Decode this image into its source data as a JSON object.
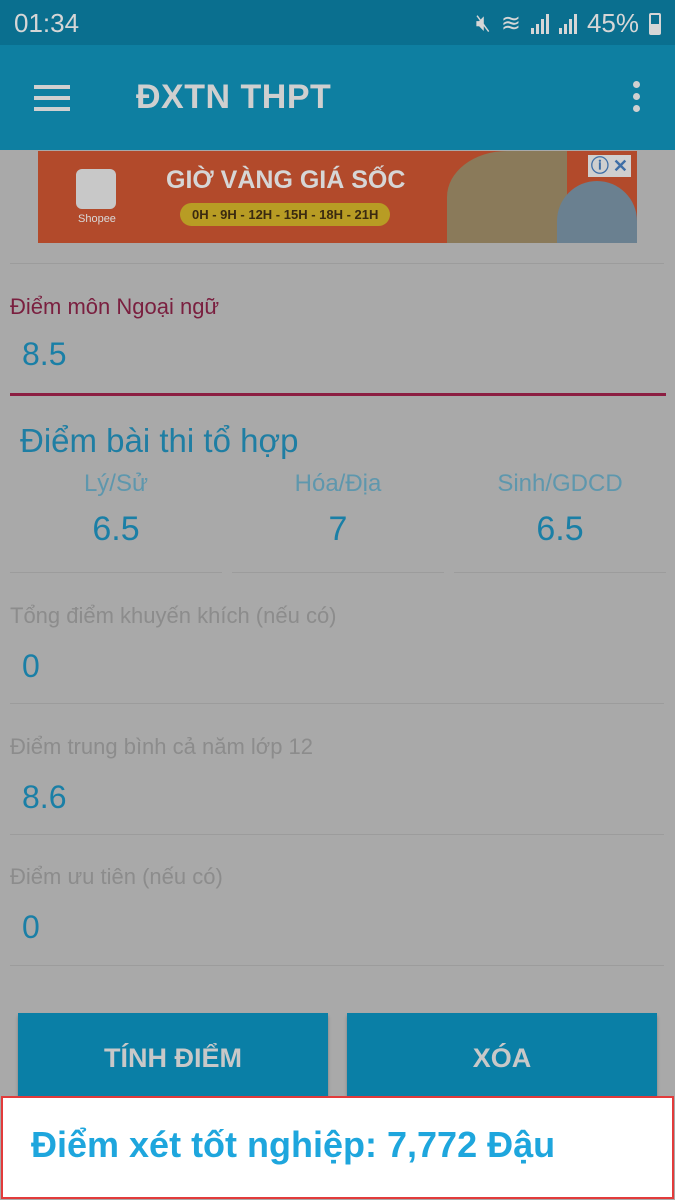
{
  "status_bar": {
    "time": "01:34",
    "battery": "45%"
  },
  "app_bar": {
    "title": "ĐXTN THPT"
  },
  "ad": {
    "brand": "Shopee",
    "headline": "GIỜ VÀNG GIÁ SỐC",
    "hours": "0H - 9H - 12H - 15H - 18H - 21H",
    "info": "ⓘ",
    "close": "✕"
  },
  "form": {
    "foreign_language": {
      "label": "Điểm môn Ngoại ngữ",
      "value": "8.5"
    },
    "combined_title": "Điểm bài thi tổ hợp",
    "combined": [
      {
        "label": "Lý/Sử",
        "value": "6.5"
      },
      {
        "label": "Hóa/Địa",
        "value": "7"
      },
      {
        "label": "Sinh/GDCD",
        "value": "6.5"
      }
    ],
    "encouragement": {
      "label": "Tổng điểm khuyến khích (nếu có)",
      "value": "0"
    },
    "grade12_average": {
      "label": "Điểm trung bình cả năm lớp 12",
      "value": "8.6"
    },
    "priority": {
      "label": "Điểm ưu tiên (nếu có)",
      "value": "0"
    }
  },
  "buttons": {
    "calculate": "TÍNH ĐIỂM",
    "clear": "XÓA"
  },
  "result": {
    "text": "Điểm xét tốt nghiệp: 7,772 Đậu"
  },
  "colors": {
    "accent": "#1ea6dd",
    "focus_underline": "#8c1e42",
    "result_border": "#e23b3b"
  }
}
